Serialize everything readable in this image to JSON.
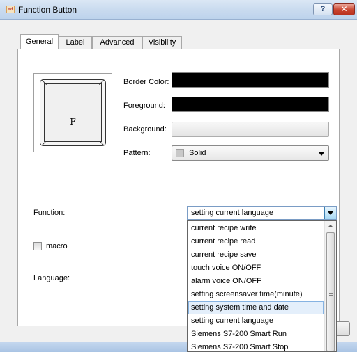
{
  "window": {
    "title": "Function Button",
    "icon_name": "app-icon",
    "help_label": "?",
    "close_label": "✕"
  },
  "tabs": [
    {
      "label": "General",
      "active": true
    },
    {
      "label": "Label",
      "active": false
    },
    {
      "label": "Advanced",
      "active": false
    },
    {
      "label": "Visibility",
      "active": false
    }
  ],
  "preview": {
    "letter": "F"
  },
  "appearance": {
    "border_color_label": "Border Color:",
    "foreground_label": "Foreground:",
    "background_label": "Background:",
    "pattern_label": "Pattern:",
    "pattern_value": "Solid",
    "border_color": "#000000",
    "foreground_color": "#000000"
  },
  "function": {
    "label": "Function:",
    "selected": "setting current language"
  },
  "macro_label": "macro",
  "language_label": "Language:",
  "dropdown": {
    "options": [
      "current recipe write",
      "current recipe read",
      "current recipe save",
      "touch voice ON/OFF",
      "alarm voice ON/OFF",
      "setting screensaver time(minute)",
      "setting system time and date",
      "setting current language",
      "Siemens S7-200 Smart Run",
      "Siemens S7-200 Smart Stop"
    ],
    "highlighted": "setting system time and date"
  }
}
